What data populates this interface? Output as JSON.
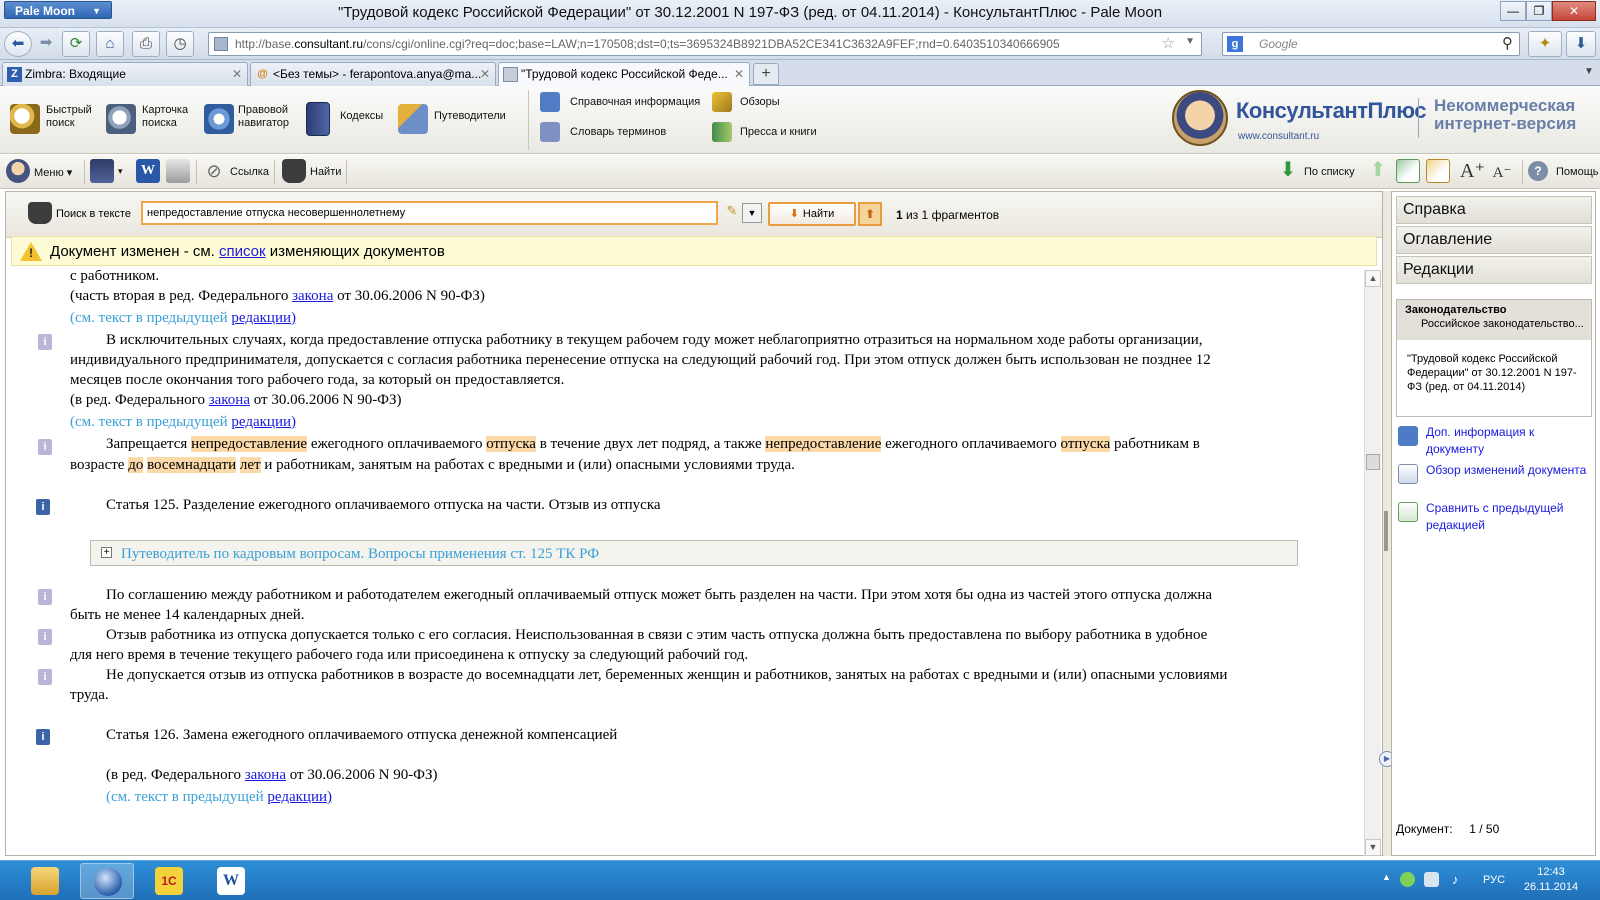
{
  "browser": {
    "app_menu": "Pale Moon",
    "window_title": "\"Трудовой кодекс Российской Федерации\" от 30.12.2001 N 197-ФЗ (ред. от 04.11.2014) - КонсультантПлюс - Pale Moon",
    "url_prefix": "http://base.",
    "url_host": "consultant.ru",
    "url_rest": "/cons/cgi/online.cgi?req=doc;base=LAW;n=170508;dst=0;ts=3695324B8921DBA52CE341C3632A9FEF;rnd=0.6403510340666905",
    "search_placeholder": "Google",
    "tabs": [
      {
        "label": "Zimbra: Входящие",
        "icon": "zimbra-icon"
      },
      {
        "label": "<Без темы> - ferapontova.anya@ma...",
        "icon": "mail-icon"
      },
      {
        "label": "\"Трудовой кодекс Российской Феде...",
        "icon": "document-icon"
      }
    ],
    "new_tab": "+"
  },
  "toolbar": {
    "quick_search": "Быстрый\nпоиск",
    "search_card": "Карточка\nпоиска",
    "legal_navigator": "Правовой\nнавигатор",
    "codes": "Кодексы",
    "guides": "Путеводители",
    "reference_info": "Справочная информация",
    "reviews": "Обзоры",
    "dictionary": "Словарь терминов",
    "press": "Пресса и книги",
    "logo_text": "КонсультантПлюс",
    "logo_url": "www.consultant.ru",
    "logo_sub": "Некоммерческая\nинтернет-версия"
  },
  "doc_toolbar": {
    "menu": "Меню",
    "link": "Ссылка",
    "find": "Найти",
    "by_list": "По списку",
    "help": "Помощь"
  },
  "search": {
    "label": "Поиск в тексте",
    "value": "непредоставление отпуска несовершеннолетнему",
    "find_button": "Найти",
    "count_current": "1",
    "count_rest": " из 1 фрагментов"
  },
  "warning": {
    "before": "Документ изменен - см. ",
    "link": "список",
    "after": " изменяющих документов"
  },
  "document": {
    "l01": "с работником.",
    "l02a": "(часть вторая в ред. Федерального ",
    "l02b": "закона",
    "l02c": " от 30.06.2006 N 90-ФЗ)",
    "l03a": "(см. текст в предыдущей ",
    "l03b": "редакции)",
    "l04": "В исключительных случаях, когда предоставление отпуска работнику в текущем рабочем году может неблагоприятно отразиться на нормальном ходе работы организации,",
    "l05": "индивидуального предпринимателя, допускается с согласия работника перенесение отпуска на следующий рабочий год. При этом отпуск должен быть использован не позднее 12",
    "l06": "месяцев после окончания того рабочего года, за который он предоставляется.",
    "l07a": "(в ред. Федерального ",
    "l07b": "закона",
    "l07c": " от 30.06.2006 N 90-ФЗ)",
    "l08a": "(см. текст в предыдущей ",
    "l08b": "редакции)",
    "l09_1": "Запрещается ",
    "l09_2": "непредоставление",
    "l09_3": " ежегодного оплачиваемого ",
    "l09_4": "отпуска",
    "l09_5": " в течение двух лет подряд, а также ",
    "l09_6": "непредоставление",
    "l09_7": " ежегодного оплачиваемого ",
    "l09_8": "отпуска",
    "l09_9": " работникам в",
    "l10_1": "возрасте ",
    "l10_2": "до",
    "l10_3": " ",
    "l10_4": "восемнадцати",
    "l10_5": " ",
    "l10_6": "лет",
    "l10_7": " и работникам, занятым на работах с вредными и (или) опасными условиями труда.",
    "art125": "Статья 125. Разделение ежегодного оплачиваемого отпуска на части. Отзыв из отпуска",
    "guide": "Путеводитель по кадровым вопросам. Вопросы применения ст. 125 ТК РФ",
    "l12": "По соглашению между работником и работодателем ежегодный оплачиваемый отпуск может быть разделен на части. При этом хотя бы одна из частей этого отпуска должна",
    "l13": "быть не менее 14 календарных дней.",
    "l14": "Отзыв работника из отпуска допускается только с его согласия. Неиспользованная в связи с этим часть отпуска должна быть предоставлена по выбору работника в удобное",
    "l15": "для него время в течение текущего рабочего года или присоединена к отпуску за следующий рабочий год.",
    "l16": "Не допускается отзыв из отпуска работников в возрасте до восемнадцати лет, беременных женщин и работников, занятых на работах с вредными и (или) опасными условиями",
    "l17": "труда.",
    "art126": "Статья 126. Замена ежегодного оплачиваемого отпуска денежной компенсацией",
    "l19a": "(в ред. Федерального ",
    "l19b": "закона",
    "l19c": " от 30.06.2006 N 90-ФЗ)",
    "l20a": "(см. текст в предыдущей ",
    "l20b": "редакции)"
  },
  "right_panel": {
    "tabs": [
      "Справка",
      "Оглавление",
      "Редакции"
    ],
    "legis_title": "Законодательство",
    "legis_sub": "Российское законодательство...",
    "legis_doc": "\"Трудовой кодекс Российской Федерации\" от 30.12.2001 N 197-ФЗ (ред. от 04.11.2014)",
    "links": [
      "Доп. информация к документу",
      "Обзор изменений документа",
      "Сравнить с предыдущей редакцией"
    ],
    "doc_label": "Документ:",
    "doc_pos": "1 / 50"
  },
  "taskbar": {
    "lang": "РУС",
    "time": "12:43",
    "date": "26.11.2014"
  },
  "colors": {
    "highlight": "#fbd9a8",
    "link": "#1a1ae0",
    "light_link": "#3aa0d8",
    "taskbar": "#2e8fd7"
  }
}
